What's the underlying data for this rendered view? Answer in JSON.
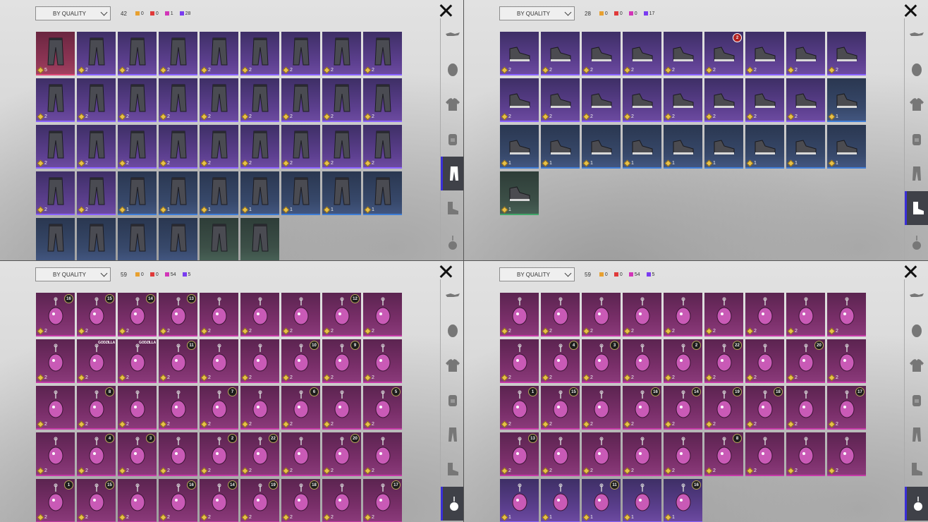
{
  "quality_colors": {
    "orange": "#e8a030",
    "red": "#e03a3a",
    "magenta": "#d236b8",
    "purple": "#7a3cf0"
  },
  "panels": [
    {
      "sort_label": "BY QUALITY",
      "total": "42",
      "counts": [
        "0",
        "0",
        "1",
        "28"
      ],
      "active_tab": 4,
      "icon": "pants",
      "items": [
        {
          "r": "pk",
          "v": "5"
        },
        {
          "r": "p",
          "v": "2"
        },
        {
          "r": "p",
          "v": "2"
        },
        {
          "r": "p",
          "v": "2"
        },
        {
          "r": "p",
          "v": "2"
        },
        {
          "r": "p",
          "v": "2"
        },
        {
          "r": "p",
          "v": "2"
        },
        {
          "r": "p",
          "v": "2"
        },
        {
          "r": "p",
          "v": "2"
        },
        {
          "r": "p",
          "v": "2"
        },
        {
          "r": "p",
          "v": "2"
        },
        {
          "r": "p",
          "v": "2"
        },
        {
          "r": "p",
          "v": "2"
        },
        {
          "r": "p",
          "v": "2"
        },
        {
          "r": "p",
          "v": "2"
        },
        {
          "r": "p",
          "v": "2"
        },
        {
          "r": "p",
          "v": "2"
        },
        {
          "r": "p",
          "v": "2"
        },
        {
          "r": "p",
          "v": "2"
        },
        {
          "r": "p",
          "v": "2"
        },
        {
          "r": "p",
          "v": "2"
        },
        {
          "r": "p",
          "v": "2"
        },
        {
          "r": "p",
          "v": "2"
        },
        {
          "r": "p",
          "v": "2"
        },
        {
          "r": "p",
          "v": "2"
        },
        {
          "r": "p",
          "v": "2"
        },
        {
          "r": "p",
          "v": "2"
        },
        {
          "r": "p",
          "v": "2"
        },
        {
          "r": "p",
          "v": "2"
        },
        {
          "r": "b",
          "v": "1"
        },
        {
          "r": "b",
          "v": "1"
        },
        {
          "r": "b",
          "v": "1"
        },
        {
          "r": "b",
          "v": "1"
        },
        {
          "r": "b",
          "v": "1"
        },
        {
          "r": "b",
          "v": "1"
        },
        {
          "r": "b",
          "v": "1"
        },
        {
          "r": "b",
          "v": ""
        },
        {
          "r": "b",
          "v": ""
        },
        {
          "r": "b",
          "v": ""
        },
        {
          "r": "b",
          "v": ""
        },
        {
          "r": "g",
          "v": ""
        },
        {
          "r": "g",
          "v": ""
        }
      ]
    },
    {
      "sort_label": "BY QUALITY",
      "total": "28",
      "counts": [
        "0",
        "0",
        "0",
        "17"
      ],
      "active_tab": 5,
      "icon": "shoe",
      "items": [
        {
          "r": "p",
          "v": "2"
        },
        {
          "r": "p",
          "v": "2"
        },
        {
          "r": "p",
          "v": "2"
        },
        {
          "r": "p",
          "v": "2"
        },
        {
          "r": "p",
          "v": "2"
        },
        {
          "r": "p",
          "v": "2",
          "badge": "2",
          "badge_red": true
        },
        {
          "r": "p",
          "v": "2"
        },
        {
          "r": "p",
          "v": "2"
        },
        {
          "r": "p",
          "v": "2"
        },
        {
          "r": "p",
          "v": "2"
        },
        {
          "r": "p",
          "v": "2"
        },
        {
          "r": "p",
          "v": "2"
        },
        {
          "r": "p",
          "v": "2"
        },
        {
          "r": "p",
          "v": "2"
        },
        {
          "r": "p",
          "v": "2"
        },
        {
          "r": "p",
          "v": "2"
        },
        {
          "r": "p",
          "v": "2"
        },
        {
          "r": "b",
          "v": "1"
        },
        {
          "r": "b",
          "v": "1"
        },
        {
          "r": "b",
          "v": "1"
        },
        {
          "r": "b",
          "v": "1"
        },
        {
          "r": "b",
          "v": "1"
        },
        {
          "r": "b",
          "v": "1"
        },
        {
          "r": "b",
          "v": "1"
        },
        {
          "r": "b",
          "v": "1"
        },
        {
          "r": "b",
          "v": "1"
        },
        {
          "r": "b",
          "v": "1"
        },
        {
          "r": "g",
          "v": "1"
        }
      ]
    },
    {
      "sort_label": "BY QUALITY",
      "total": "59",
      "counts": [
        "0",
        "0",
        "54",
        "5"
      ],
      "active_tab": 6,
      "icon": "charm",
      "items": [
        {
          "r": "m",
          "v": "2",
          "badge": "16"
        },
        {
          "r": "m",
          "v": "2",
          "badge": "15"
        },
        {
          "r": "m",
          "v": "2",
          "badge": "14"
        },
        {
          "r": "m",
          "v": "2",
          "badge": "13"
        },
        {
          "r": "m",
          "v": "2"
        },
        {
          "r": "m",
          "v": "2"
        },
        {
          "r": "m",
          "v": "2"
        },
        {
          "r": "m",
          "v": "2",
          "badge": "12"
        },
        {
          "r": "m",
          "v": "2"
        },
        {
          "r": "m",
          "v": "2"
        },
        {
          "r": "m",
          "v": "2",
          "tag": "GODZILLA"
        },
        {
          "r": "m",
          "v": "2",
          "tag": "GODZILLA"
        },
        {
          "r": "m",
          "v": "2",
          "badge": "11"
        },
        {
          "r": "m",
          "v": "2"
        },
        {
          "r": "m",
          "v": "2"
        },
        {
          "r": "m",
          "v": "2",
          "badge": "10"
        },
        {
          "r": "m",
          "v": "2",
          "badge": "9"
        },
        {
          "r": "m",
          "v": "2"
        },
        {
          "r": "m",
          "v": "2"
        },
        {
          "r": "m",
          "v": "2",
          "badge": "8"
        },
        {
          "r": "m",
          "v": "2"
        },
        {
          "r": "m",
          "v": "2"
        },
        {
          "r": "m",
          "v": "2",
          "badge": "7"
        },
        {
          "r": "m",
          "v": "2"
        },
        {
          "r": "m",
          "v": "2",
          "badge": "6"
        },
        {
          "r": "m",
          "v": "2"
        },
        {
          "r": "m",
          "v": "2",
          "badge": "5"
        },
        {
          "r": "m",
          "v": "2"
        },
        {
          "r": "m",
          "v": "2",
          "badge": "4"
        },
        {
          "r": "m",
          "v": "2",
          "badge": "3"
        },
        {
          "r": "m",
          "v": "2"
        },
        {
          "r": "m",
          "v": "2",
          "badge": "2"
        },
        {
          "r": "m",
          "v": "2",
          "badge": "22"
        },
        {
          "r": "m",
          "v": "2"
        },
        {
          "r": "m",
          "v": "2",
          "badge": "20"
        },
        {
          "r": "m",
          "v": "2"
        },
        {
          "r": "m",
          "v": "2",
          "badge": "1"
        },
        {
          "r": "m",
          "v": "2",
          "badge": "15"
        },
        {
          "r": "m",
          "v": "2"
        },
        {
          "r": "m",
          "v": "2",
          "badge": "16"
        },
        {
          "r": "m",
          "v": "2",
          "badge": "14"
        },
        {
          "r": "m",
          "v": "2",
          "badge": "19"
        },
        {
          "r": "m",
          "v": "2",
          "badge": "18"
        },
        {
          "r": "m",
          "v": "2"
        },
        {
          "r": "m",
          "v": "2",
          "badge": "17"
        }
      ]
    },
    {
      "sort_label": "BY QUALITY",
      "total": "59",
      "counts": [
        "0",
        "0",
        "54",
        "5"
      ],
      "active_tab": 6,
      "icon": "charm",
      "items": [
        {
          "r": "m",
          "v": "2"
        },
        {
          "r": "m",
          "v": "2"
        },
        {
          "r": "m",
          "v": "2"
        },
        {
          "r": "m",
          "v": "2"
        },
        {
          "r": "m",
          "v": "2"
        },
        {
          "r": "m",
          "v": "2"
        },
        {
          "r": "m",
          "v": "2"
        },
        {
          "r": "m",
          "v": "2"
        },
        {
          "r": "m",
          "v": "2"
        },
        {
          "r": "m",
          "v": "2"
        },
        {
          "r": "m",
          "v": "2",
          "badge": "4"
        },
        {
          "r": "m",
          "v": "2",
          "badge": "3"
        },
        {
          "r": "m",
          "v": "2"
        },
        {
          "r": "m",
          "v": "2",
          "badge": "2"
        },
        {
          "r": "m",
          "v": "2",
          "badge": "22"
        },
        {
          "r": "m",
          "v": "2"
        },
        {
          "r": "m",
          "v": "2",
          "badge": "20"
        },
        {
          "r": "m",
          "v": "2"
        },
        {
          "r": "m",
          "v": "2",
          "badge": "1"
        },
        {
          "r": "m",
          "v": "2",
          "badge": "15"
        },
        {
          "r": "m",
          "v": "2"
        },
        {
          "r": "m",
          "v": "2",
          "badge": "16"
        },
        {
          "r": "m",
          "v": "2",
          "badge": "14"
        },
        {
          "r": "m",
          "v": "2",
          "badge": "19"
        },
        {
          "r": "m",
          "v": "2",
          "badge": "18"
        },
        {
          "r": "m",
          "v": "2"
        },
        {
          "r": "m",
          "v": "2",
          "badge": "17"
        },
        {
          "r": "m",
          "v": "2",
          "badge": "13"
        },
        {
          "r": "m",
          "v": "2"
        },
        {
          "r": "m",
          "v": "2"
        },
        {
          "r": "m",
          "v": "2"
        },
        {
          "r": "m",
          "v": "2"
        },
        {
          "r": "m",
          "v": "2",
          "badge": "8"
        },
        {
          "r": "m",
          "v": "2"
        },
        {
          "r": "m",
          "v": "2"
        },
        {
          "r": "m",
          "v": "2"
        },
        {
          "r": "p",
          "v": "1"
        },
        {
          "r": "p",
          "v": "1"
        },
        {
          "r": "p",
          "v": "1",
          "badge": "11"
        },
        {
          "r": "p",
          "v": "1"
        },
        {
          "r": "p",
          "v": "1",
          "badge": "16"
        }
      ]
    }
  ]
}
